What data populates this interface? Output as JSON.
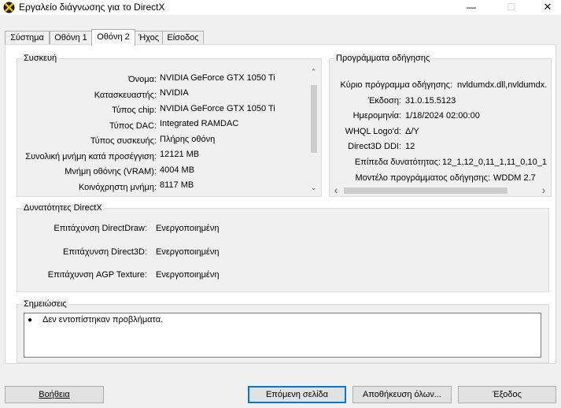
{
  "window": {
    "title": "Εργαλείο διάγνωσης για το DirectX",
    "minimize_glyph": "—",
    "maximize_glyph": "☐",
    "close_glyph": "✕"
  },
  "tabs": [
    {
      "label": "Σύστημα",
      "active": false
    },
    {
      "label": "Οθόνη 1",
      "active": false
    },
    {
      "label": "Οθόνη 2",
      "active": true
    },
    {
      "label": "Ήχος",
      "active": false
    },
    {
      "label": "Είσοδος",
      "active": false
    }
  ],
  "device": {
    "title": "Συσκευή",
    "rows": [
      {
        "label": "Όνομα:",
        "value": "NVIDIA GeForce GTX 1050 Ti"
      },
      {
        "label": "Κατασκευαστής:",
        "value": "NVIDIA"
      },
      {
        "label": "Τύπος chip:",
        "value": "NVIDIA GeForce GTX 1050 Ti"
      },
      {
        "label": "Τύπος DAC:",
        "value": "Integrated RAMDAC"
      },
      {
        "label": "Τύπος συσκευής:",
        "value": "Πλήρης οθόνη"
      },
      {
        "label": "Συνολική μνήμη κατά προσέγγιση:",
        "value": "12121 MB"
      },
      {
        "label": "Μνήμη οθόνης (VRAM):",
        "value": "4004 MB"
      },
      {
        "label": "Κοινόχρηστη μνήμη:",
        "value": "8117 MB"
      }
    ]
  },
  "drivers": {
    "title": "Προγράμματα οδήγησης",
    "rows": [
      {
        "label": "Κύριο πρόγραμμα οδήγησης:",
        "value": "nvldumdx.dll,nvldumdx."
      },
      {
        "label": "Έκδοση:",
        "value": "31.0.15.5123"
      },
      {
        "label": "Ημερομηνία:",
        "value": "1/18/2024 02:00:00"
      },
      {
        "label": "WHQL Logo'd:",
        "value": "Δ/Υ"
      },
      {
        "label": "Direct3D DDI:",
        "value": "12"
      },
      {
        "label": "Επίπεδα δυνατότητας:",
        "value": "12_1,12_0,11_1,11_0,10_1"
      },
      {
        "label": "Μοντέλο προγράμματος οδήγησης:",
        "value": "WDDM 2.7"
      }
    ]
  },
  "directx": {
    "title": "Δυνατότητες DirectX",
    "rows": [
      {
        "label": "Επιτάχυνση DirectDraw:",
        "value": "Ενεργοποιημένη"
      },
      {
        "label": "Επιτάχυνση Direct3D:",
        "value": "Ενεργοποιημένη"
      },
      {
        "label": "Επιτάχυνση AGP Texture:",
        "value": "Ενεργοποιημένη"
      }
    ]
  },
  "notes": {
    "title": "Σημειώσεις",
    "items": [
      "Δεν εντοπίστηκαν προβλήματα."
    ]
  },
  "buttons": {
    "help": "Βοήθεια",
    "next": "Επόμενη σελίδα",
    "save": "Αποθήκευση όλων...",
    "exit": "Έξοδος"
  },
  "scroll_glyphs": {
    "up": "⌃",
    "down": "⌄",
    "left": "‹",
    "right": "›"
  }
}
